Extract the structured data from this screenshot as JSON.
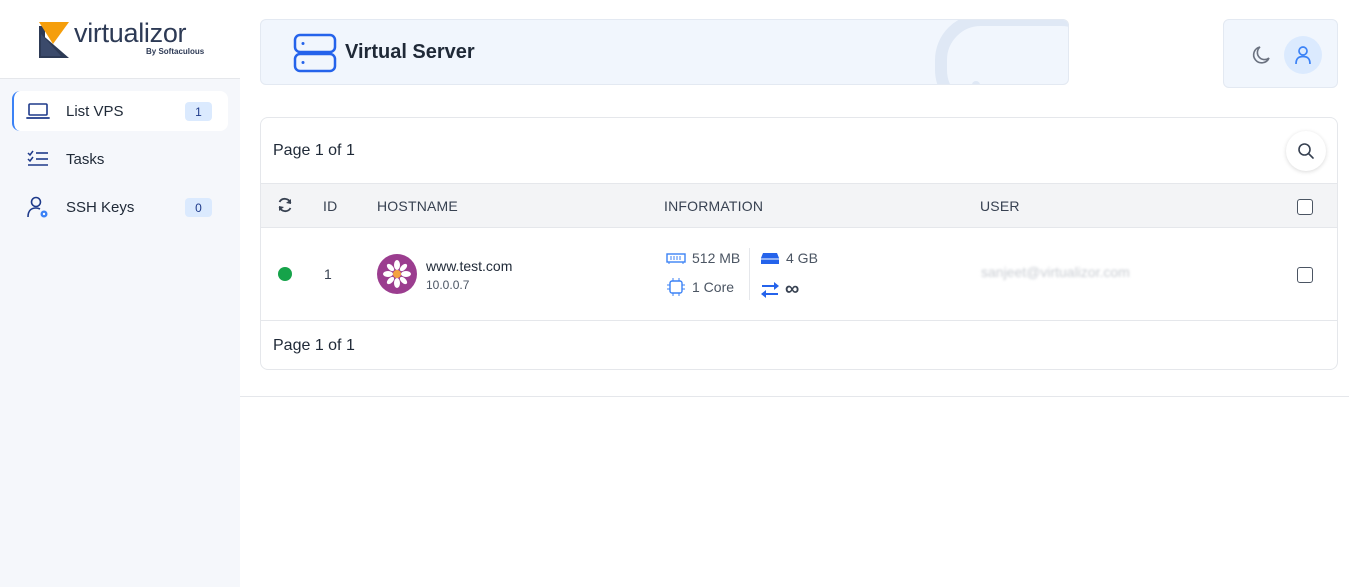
{
  "brand": {
    "name": "virtualizor",
    "by": "By Softaculous"
  },
  "sidebar": {
    "items": [
      {
        "label": "List VPS",
        "badge": "1",
        "icon": "laptop-icon",
        "active": true
      },
      {
        "label": "Tasks",
        "icon": "tasks-checklist-icon",
        "active": false
      },
      {
        "label": "SSH Keys",
        "badge": "0",
        "icon": "user-key-icon",
        "active": false
      }
    ]
  },
  "header": {
    "title": "Virtual Server",
    "icon": "server-icon"
  },
  "top_actions": {
    "theme_icon": "moon-icon",
    "user_icon": "user-icon"
  },
  "table": {
    "pagination_top": "Page 1 of 1",
    "pagination_bottom": "Page 1 of 1",
    "columns": [
      "ID",
      "HOSTNAME",
      "INFORMATION",
      "USER"
    ],
    "rows": [
      {
        "status": "online",
        "status_color": "#16a34a",
        "id": "1",
        "hostname": "www.test.com",
        "ip": "10.0.0.7",
        "ram": "512 MB",
        "disk": "4 GB",
        "cpu": "1 Core",
        "bandwidth": "∞",
        "user": "sanjeet@virtualizor.com"
      }
    ]
  },
  "colors": {
    "accent": "#3b82f6",
    "badge_bg": "#dbeafe",
    "header_bg": "#f1f6fd",
    "sidebar_bg": "#f5f7fb",
    "os_logo": "#9b3d8f"
  }
}
